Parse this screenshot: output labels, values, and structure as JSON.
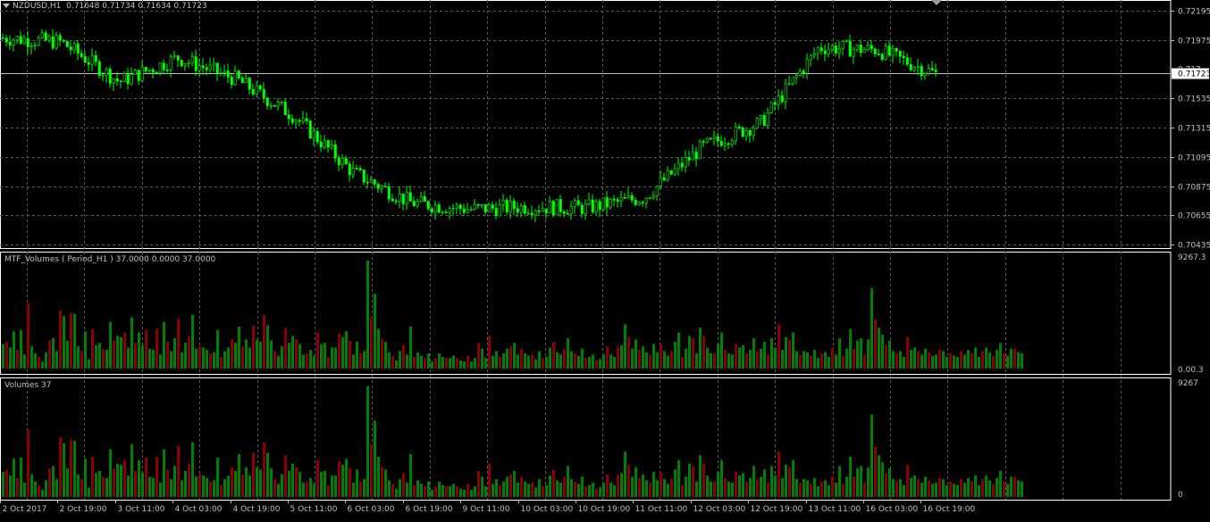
{
  "main_panel": {
    "symbol_label": "NZDUSD,H1",
    "ohlc_text": "0.71648 0.71734 0.71634 0.71723",
    "current_price_label": "0.71723",
    "price_axis_labels": [
      "0.72195",
      "0.71975",
      "0.71535",
      "0.71315",
      "0.71095",
      "0.70875",
      "0.70655",
      "0.70435"
    ],
    "price_axis_partial_label": "0.717",
    "collapse_icon": "triangle-down-icon",
    "shift_marker_icon": "gray-triangle-icon"
  },
  "mtf_panel": {
    "title": "MTF_Volumes ( Period_H1 ) 37.0000 0.0000 37.0000",
    "axis_top": "9267.3",
    "axis_bottom": "0.00.3"
  },
  "volume_panel": {
    "title": "Volumes 37",
    "axis_top": "9267",
    "axis_bottom": "0"
  },
  "time_axis": {
    "labels": [
      "2 Oct 2017",
      "2 Oct 19:00",
      "3 Oct 11:00",
      "4 Oct 03:00",
      "4 Oct 19:00",
      "5 Oct 11:00",
      "6 Oct 03:00",
      "6 Oct 19:00",
      "9 Oct 11:00",
      "10 Oct 03:00",
      "10 Oct 19:00",
      "11 Oct 11:00",
      "12 Oct 03:00",
      "12 Oct 19:00",
      "13 Oct 11:00",
      "16 Oct 03:00",
      "16 Oct 19:00"
    ]
  },
  "colors": {
    "background": "#000000",
    "grid": "#5a5a5a",
    "text": "#c0c0c0",
    "candle": "#00ff00",
    "volume_up": "#008000",
    "volume_down": "#8b0000",
    "price_line": "#c0c0c0",
    "separator": "#ffffff"
  },
  "chart_data": [
    {
      "type": "line",
      "name": "NZDUSD H1 price",
      "x": [
        "2 Oct 2017",
        "2 Oct 19:00",
        "3 Oct 11:00",
        "4 Oct 03:00",
        "4 Oct 19:00",
        "5 Oct 11:00",
        "6 Oct 03:00",
        "6 Oct 19:00",
        "9 Oct 11:00",
        "10 Oct 03:00",
        "10 Oct 19:00",
        "11 Oct 11:00",
        "12 Oct 03:00",
        "12 Oct 19:00",
        "13 Oct 11:00",
        "16 Oct 03:00",
        "16 Oct 19:00"
      ],
      "y": [
        0.7199,
        0.7196,
        0.7166,
        0.7184,
        0.7168,
        0.714,
        0.7098,
        0.7075,
        0.707,
        0.7072,
        0.7071,
        0.7079,
        0.7117,
        0.7135,
        0.7192,
        0.719,
        0.7172
      ],
      "ylim": [
        0.70435,
        0.72195
      ]
    },
    {
      "type": "bar",
      "name": "Volumes",
      "ylim": [
        0,
        9267
      ],
      "values": [
        2100,
        2300,
        1800,
        3200,
        1600,
        3300,
        1200,
        5600,
        1900,
        1300,
        1000,
        600,
        1400,
        2400,
        2600,
        1500,
        5000,
        4500,
        2400,
        4800,
        4700,
        1900,
        1500,
        3200,
        800,
        3400,
        2000,
        2200,
        1700,
        1600,
        4000,
        2400,
        2800,
        2700,
        3100,
        1800,
        4400,
        2200,
        3100,
        2000,
        3300,
        1700,
        1600,
        3400,
        1200,
        4000,
        2300,
        1500,
        2600,
        4300,
        1400,
        2200,
        2800,
        4600,
        1700,
        1900,
        1800,
        1600,
        1300,
        1400,
        3300,
        1000,
        1500,
        1800,
        2500,
        2200,
        3600,
        1900,
        2500,
        1800,
        3700,
        2500,
        2300,
        4600,
        3700,
        2400,
        1500,
        1100,
        1900,
        3500,
        2200,
        2800,
        2500,
        2100,
        1200,
        1300,
        1600,
        1100,
        3100,
        2100,
        2200,
        1000,
        1800,
        1800,
        3000,
        2700,
        3200,
        2400,
        1200,
        2300,
        1300,
        1500,
        9267,
        4400,
        6400,
        3400,
        2500,
        2300,
        1400,
        1100,
        700,
        1500,
        2000,
        1200,
        3600,
        1000,
        1400,
        1100,
        900,
        1300,
        600,
        900,
        1300,
        1000,
        900,
        900,
        1100,
        900,
        700,
        600,
        1100,
        600,
        900,
        2200,
        1700,
        900,
        2800,
        1100,
        1500,
        1000,
        1300,
        1700,
        1900,
        2200,
        1200,
        1700,
        1300,
        1100,
        1200,
        800,
        1500,
        900,
        1000,
        1800,
        2300,
        1400,
        1200,
        1700,
        2600,
        1500,
        1300,
        1100,
        1700,
        900,
        1000,
        1200,
        700,
        800,
        1200,
        1900,
        1200,
        1000,
        1900,
        2000,
        3800,
        2700,
        1700,
        2500,
        1600,
        1900,
        1400,
        1200,
        2100,
        1400,
        2100,
        1500,
        1100,
        1500,
        2300,
        3100,
        1000,
        1700,
        2800,
        2600,
        1300,
        3500,
        2800,
        1800,
        1300,
        1300,
        2100,
        3100,
        1600,
        1300,
        1200,
        2100,
        1800,
        2000,
        1300,
        1600,
        2600,
        1500,
        1700,
        2300,
        1200,
        2600,
        1800,
        3800,
        1600,
        2700,
        2500,
        3100,
        1500,
        1200,
        1500,
        1400,
        1100,
        1600,
        900,
        1300,
        1400,
        1000,
        1700,
        1200,
        2600,
        1100,
        1700,
        3400,
        1700,
        2400,
        2600,
        1200,
        2500,
        6900,
        4200,
        3500,
        2900,
        2000,
        2400,
        1500,
        1300,
        1500,
        1000,
        2700,
        1600,
        1800,
        1500,
        1200,
        1700,
        1400,
        1100,
        1200,
        1600,
        1500,
        1000,
        1300,
        1100,
        1000,
        1500,
        1200,
        1600,
        1300,
        1800,
        1000,
        1500,
        1800,
        1400,
        1100,
        1600,
        2200,
        1300,
        1100,
        1700,
        1700,
        1400,
        1300
      ],
      "colors_up_down": "green = up, dark red = down"
    }
  ]
}
